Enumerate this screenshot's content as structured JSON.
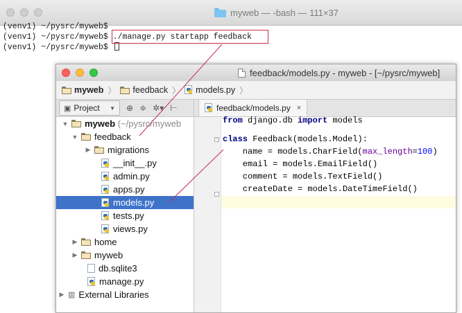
{
  "terminal": {
    "title": "myweb — -bash — 111×37",
    "lines": [
      "(venv1) ~/pysrc/myweb$",
      "(venv1) ~/pysrc/myweb$",
      "(venv1) ~/pysrc/myweb$"
    ],
    "command": "./manage.py startapp feedback"
  },
  "ide": {
    "title": "feedback/models.py - myweb - [~/pysrc/myweb]",
    "breadcrumbs": [
      "myweb",
      "feedback",
      "models.py"
    ],
    "project_label": "Project",
    "tab_label": "feedback/models.py",
    "tab_close": "×",
    "tree": {
      "root_name": "myweb",
      "root_path": "(~/pysrc/myweb",
      "feedback": "feedback",
      "migrations": "migrations",
      "init": "__init__.py",
      "admin": "admin.py",
      "apps": "apps.py",
      "models": "models.py",
      "tests": "tests.py",
      "views": "views.py",
      "home": "home",
      "myweb": "myweb",
      "db": "db.sqlite3",
      "manage": "manage.py",
      "external": "External Libraries"
    },
    "code": {
      "l1_from": "from",
      "l1_mod": " django.db ",
      "l1_import": "import",
      "l1_rest": " models",
      "l3_class": "class",
      "l3_rest": " Feedback(models.Model):",
      "l4_a": "    name = models.CharField(",
      "l4_kw": "max_length",
      "l4_eq": "=",
      "l4_num": "100",
      "l4_end": ")",
      "l5": "    email = models.EmailField()",
      "l6": "    comment = models.TextField()",
      "l7": "    createDate = models.DateTimeField()"
    }
  },
  "colors": {
    "annotation": "#c72d4b",
    "selection": "#3e73c9"
  }
}
